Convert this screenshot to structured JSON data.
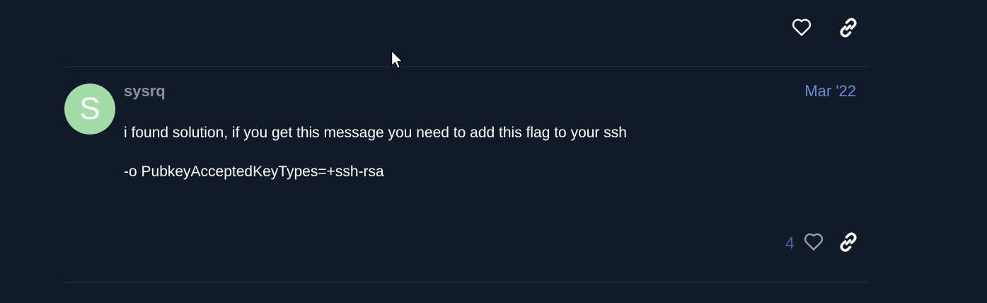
{
  "post": {
    "username": "sysrq",
    "avatar_letter": "S",
    "avatar_color": "#a3dca8",
    "date": "Mar '22",
    "paragraphs": [
      "i found solution, if you get this message you need to add this flag to your ssh",
      "-o PubkeyAcceptedKeyTypes=+ssh-rsa"
    ],
    "like_count": "4"
  },
  "icons": {
    "like": "heart-icon",
    "share": "link-icon"
  },
  "colors": {
    "background": "#121929",
    "date_link": "#6a8fd6",
    "like_count": "#4a64a8",
    "username": "#8a8f98"
  }
}
